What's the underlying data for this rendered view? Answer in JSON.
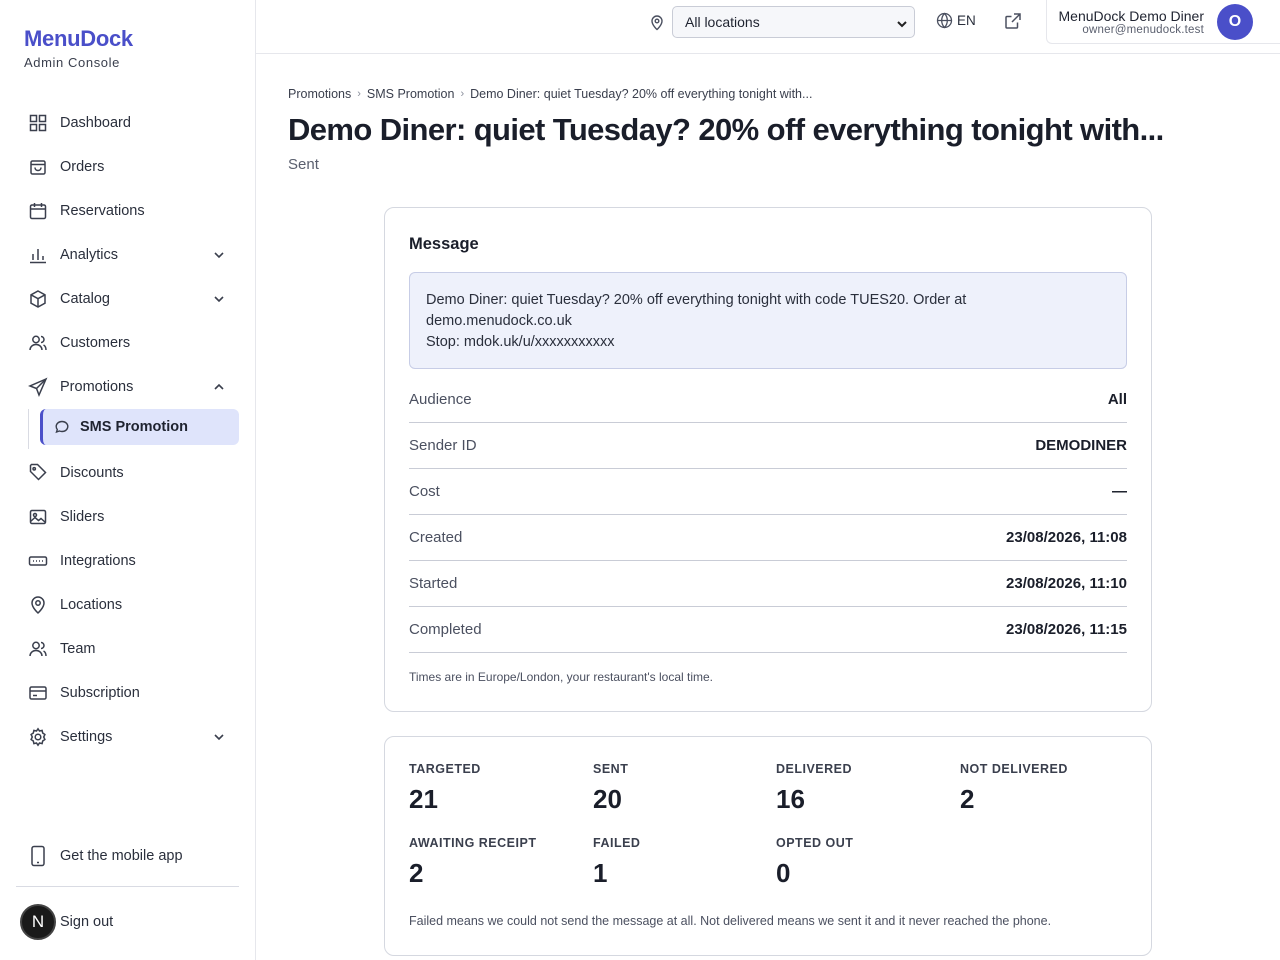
{
  "brand": {
    "name": "MenuDock",
    "subtitle": "Admin Console"
  },
  "topbar": {
    "location_select": "All locations",
    "language": "EN",
    "user_name": "MenuDock Demo Diner",
    "user_email": "owner@menudock.test",
    "user_initial": "O"
  },
  "sidebar": {
    "items": [
      {
        "label": "Dashboard",
        "icon": "grid-icon"
      },
      {
        "label": "Orders",
        "icon": "bag-icon"
      },
      {
        "label": "Reservations",
        "icon": "calendar-icon"
      },
      {
        "label": "Analytics",
        "icon": "bar-chart-icon"
      },
      {
        "label": "Catalog",
        "icon": "box-icon"
      },
      {
        "label": "Customers",
        "icon": "users-icon"
      },
      {
        "label": "Promotions",
        "icon": "send-icon"
      },
      {
        "label": "SMS Promotion",
        "icon": "chat-bubble-icon"
      },
      {
        "label": "Discounts",
        "icon": "tag-icon"
      },
      {
        "label": "Sliders",
        "icon": "image-icon"
      },
      {
        "label": "Integrations",
        "icon": "plug-icon"
      },
      {
        "label": "Locations",
        "icon": "map-pin-icon"
      },
      {
        "label": "Team",
        "icon": "team-icon"
      },
      {
        "label": "Subscription",
        "icon": "credit-card-icon"
      },
      {
        "label": "Settings",
        "icon": "gear-icon"
      }
    ],
    "mobile_app": "Get the mobile app",
    "sign_out": "Sign out",
    "sign_out_avatar": "N"
  },
  "breadcrumb": [
    "Promotions",
    "SMS Promotion",
    "Demo Diner: quiet Tuesday? 20% off everything tonight with..."
  ],
  "page": {
    "title": "Demo Diner: quiet Tuesday? 20% off everything tonight with...",
    "status": "Sent"
  },
  "message_card": {
    "title": "Message",
    "lines": [
      "Demo Diner: quiet Tuesday? 20% off everything tonight with code TUES20. Order at",
      "demo.menudock.co.uk",
      "Stop: mdok.uk/u/xxxxxxxxxxx"
    ],
    "rows": [
      {
        "label": "Audience",
        "value": "All"
      },
      {
        "label": "Sender ID",
        "value": "DEMODINER"
      },
      {
        "label": "Cost",
        "value": "—"
      },
      {
        "label": "Created",
        "value": "23/08/2026, 11:08"
      },
      {
        "label": "Started",
        "value": "23/08/2026, 11:10"
      },
      {
        "label": "Completed",
        "value": "23/08/2026, 11:15"
      }
    ],
    "timezone_note": "Times are in Europe/London, your restaurant's local time."
  },
  "stats_card": {
    "stats": [
      {
        "label": "TARGETED",
        "value": "21"
      },
      {
        "label": "SENT",
        "value": "20"
      },
      {
        "label": "DELIVERED",
        "value": "16"
      },
      {
        "label": "NOT DELIVERED",
        "value": "2"
      },
      {
        "label": "AWAITING RECEIPT",
        "value": "2"
      },
      {
        "label": "FAILED",
        "value": "1"
      },
      {
        "label": "OPTED OUT",
        "value": "0"
      }
    ],
    "note": "Failed means we could not send the message at all. Not delivered means we sent it and it never reached the phone."
  },
  "colors": {
    "accent": "#4a4fc9",
    "active_bg": "#dfe4fb",
    "message_bg": "#eef1fb"
  }
}
